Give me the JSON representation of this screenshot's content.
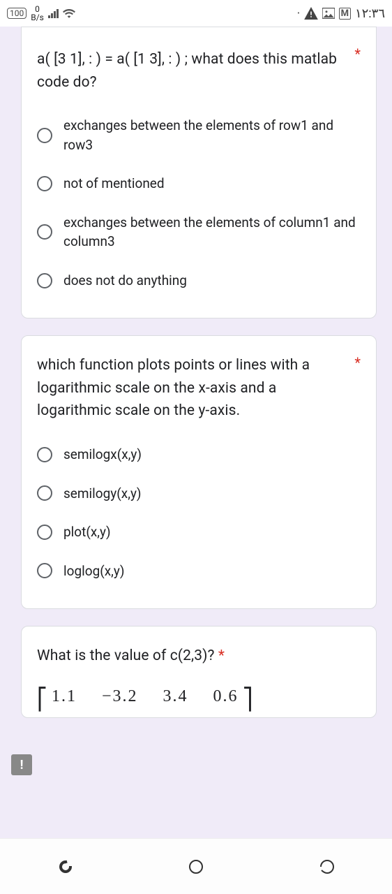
{
  "statusbar": {
    "battery_badge": "100",
    "network_rate": "0",
    "network_unit": "B/s",
    "time": "١٢:٣٦"
  },
  "questions": [
    {
      "text": "a( [3 1], : ) = a( [1 3], : ) ; what does this matlab code do?",
      "required": "*",
      "options": [
        "exchanges between the elements of row1 and row3",
        "not of mentioned",
        "exchanges between the elements of column1 and column3",
        "does not do anything"
      ]
    },
    {
      "text": "which function plots points or lines with a logarithmic scale on the x-axis and a logarithmic scale on the y-axis.",
      "required": "*",
      "options": [
        "semilogx(x,y)",
        "semilogy(x,y)",
        "plot(x,y)",
        "loglog(x,y)"
      ]
    },
    {
      "text": "What is the value of c(2,3)? ",
      "required": "*",
      "matrix_row": [
        "1.1",
        "−3.2",
        "3.4",
        "0.6"
      ]
    }
  ],
  "fab": "!"
}
